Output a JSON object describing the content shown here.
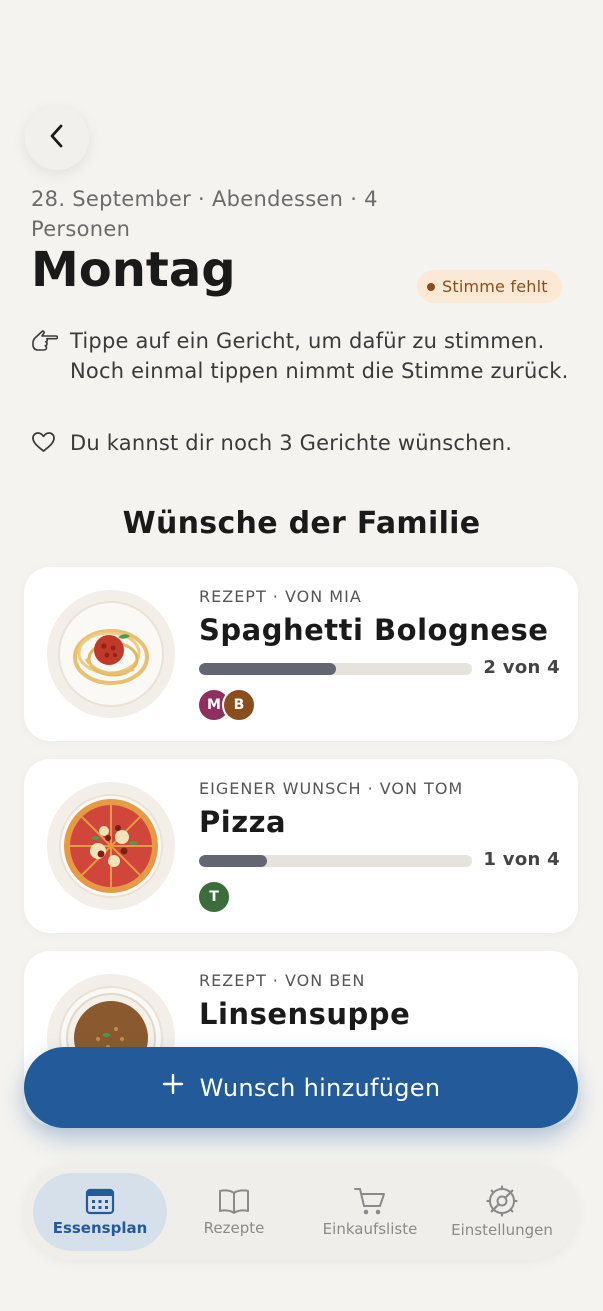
{
  "header": {
    "meta": "28. September · Abendessen · 4 Personen",
    "title": "Montag",
    "badge": "Stimme fehlt"
  },
  "hints": {
    "tap": "Tippe auf ein Gericht, um dafür zu stimmen. Noch einmal tippen nimmt die Stimme zurück.",
    "remaining": "Du kannst dir noch 3 Gerichte wünschen."
  },
  "section_title": "Wünsche der Familie",
  "dishes": [
    {
      "label": "REZEPT · VON MIA",
      "title": "Spaghetti Bolognese",
      "votes": 2,
      "total": 4,
      "progress": 0.5,
      "vote_text": "2 von 4",
      "avatars": [
        {
          "letter": "M",
          "color": "#8f2f5e"
        },
        {
          "letter": "B",
          "color": "#8a4e1c"
        }
      ]
    },
    {
      "label": "EIGENER WUNSCH · VON TOM",
      "title": "Pizza",
      "votes": 1,
      "total": 4,
      "progress": 0.25,
      "vote_text": "1 von 4",
      "avatars": [
        {
          "letter": "T",
          "color": "#3c6e3c"
        }
      ]
    },
    {
      "label": "REZEPT · VON BEN",
      "title": "Linsensuppe"
    }
  ],
  "fab": {
    "label": "Wunsch hinzufügen"
  },
  "tabs": [
    {
      "label": "Essensplan",
      "icon": "calendar-icon",
      "active": true
    },
    {
      "label": "Rezepte",
      "icon": "book-icon",
      "active": false
    },
    {
      "label": "Einkaufsliste",
      "icon": "cart-icon",
      "active": false
    },
    {
      "label": "Einstellungen",
      "icon": "gear-icon",
      "active": false
    }
  ],
  "colors": {
    "accent": "#235a9a",
    "badge_bg": "#fbe9d6",
    "badge_text": "#8a4e1c",
    "progress_fill": "#636672"
  }
}
